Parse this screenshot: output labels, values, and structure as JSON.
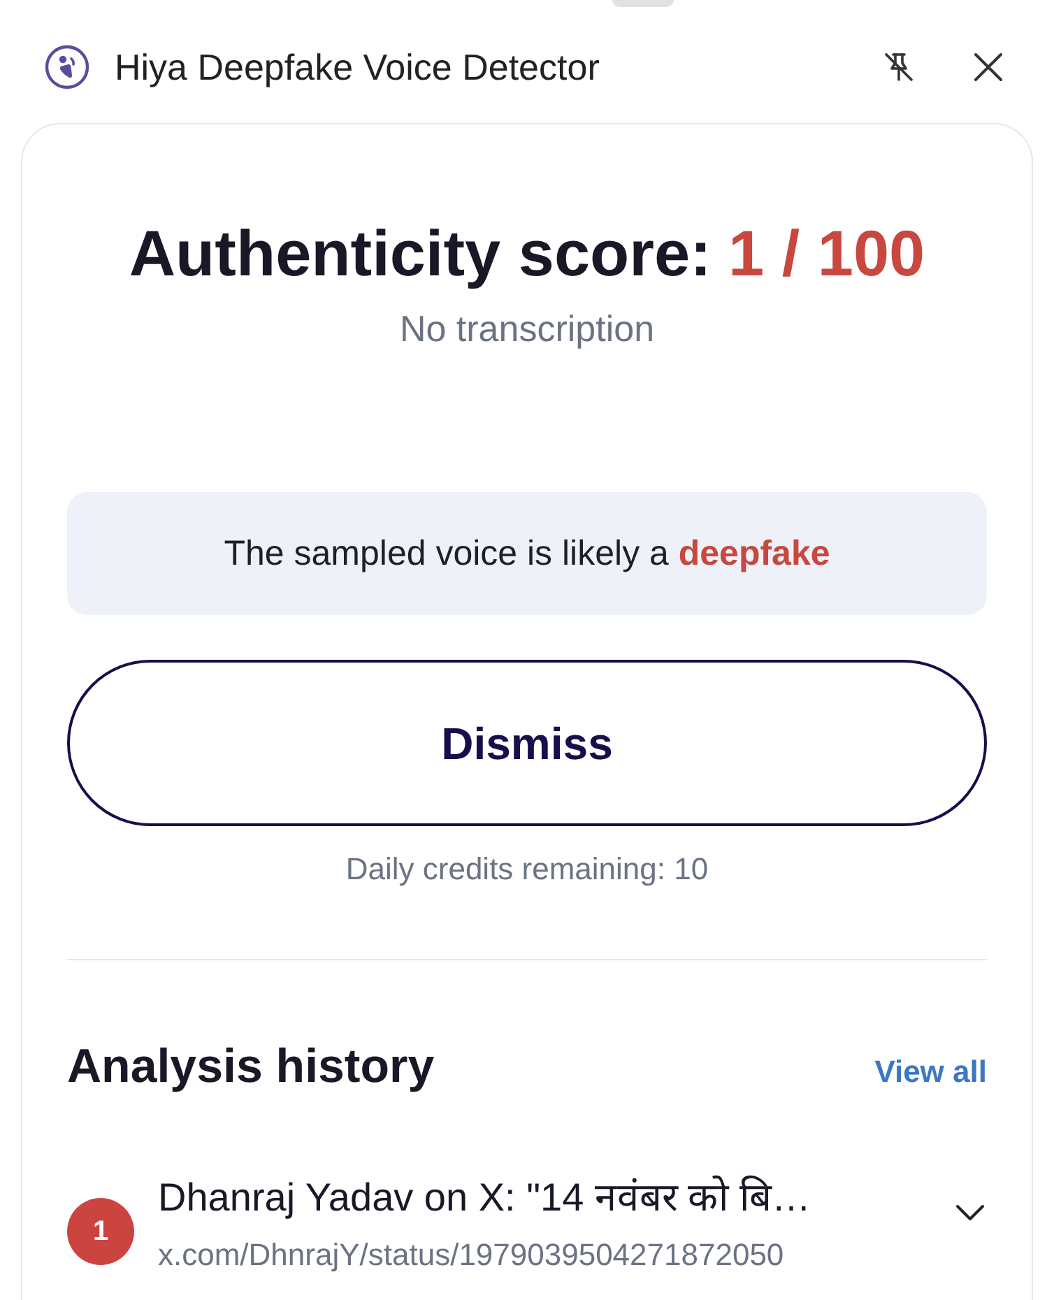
{
  "header": {
    "title": "Hiya Deepfake Voice Detector"
  },
  "result": {
    "score_label": "Authenticity score:",
    "score": "1 / 100",
    "transcription": "No transcription",
    "verdict": "The sampled voice is likely a **deepfake**",
    "dismiss_button": "Dismiss",
    "credits": "Daily credits remaining: 10"
  },
  "history": {
    "title": "Analysis history",
    "view_all": "View all",
    "items": [
      {
        "number": "1",
        "title": "Dhanraj Yadav on X: \"14 नवंबर को बि…",
        "url": "x.com/DhnrajY/status/1979039504271872050",
        "expanded": false
      }
    ]
  }
}
